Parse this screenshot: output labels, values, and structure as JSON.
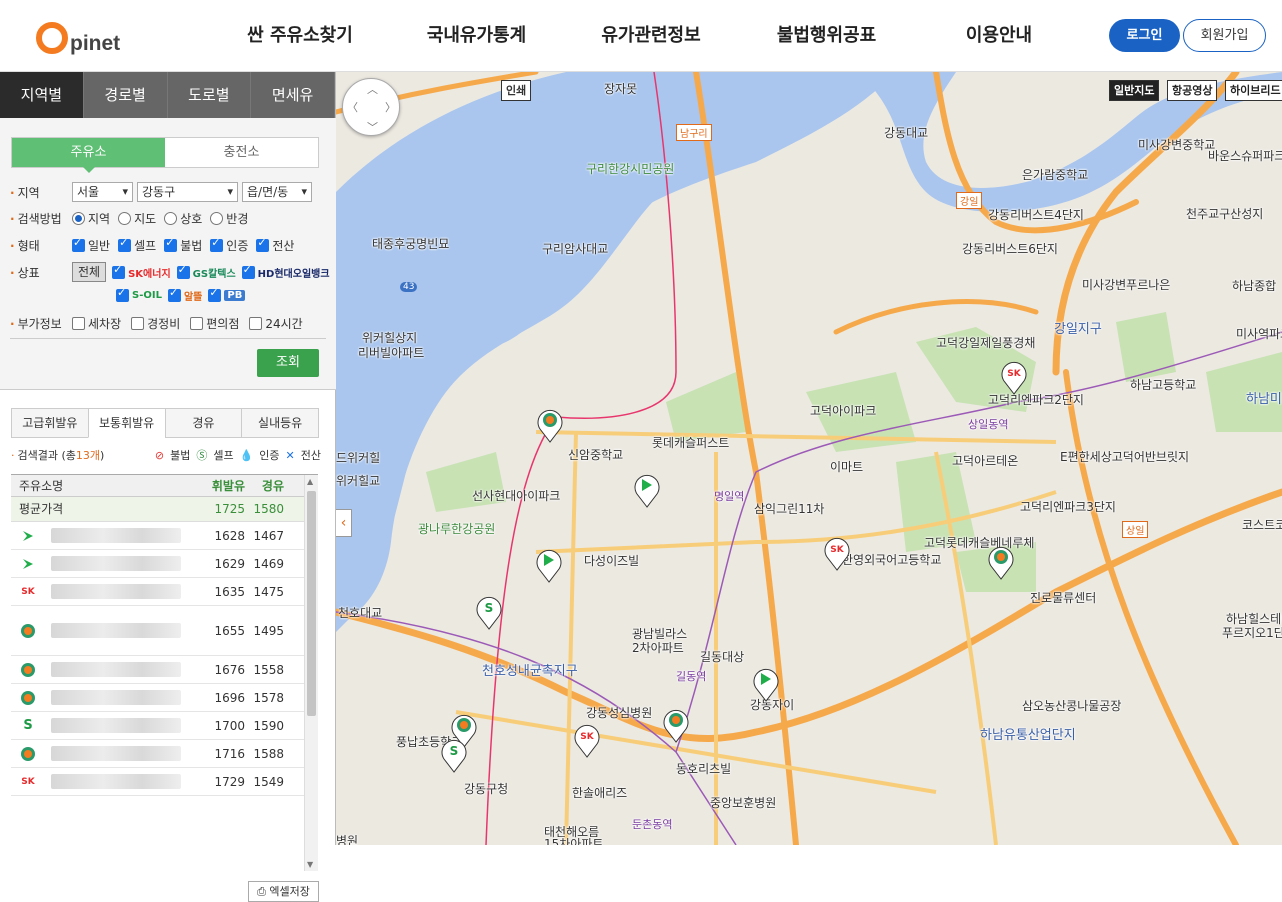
{
  "header": {
    "logo_o": "O",
    "logo_text": "pinet",
    "nav": [
      "싼 주유소찾기",
      "국내유가통계",
      "유가관련정보",
      "불법행위공표",
      "이용안내"
    ],
    "login": "로그인",
    "join": "회원가입"
  },
  "panel": {
    "tabs": [
      "지역별",
      "경로별",
      "도로별",
      "면세유"
    ],
    "subtabs": [
      "주유소",
      "충전소"
    ],
    "region": {
      "label": "지역",
      "sido": "서울",
      "sigungu": "강동구",
      "dong": "읍/면/동"
    },
    "method": {
      "label": "검색방법",
      "options": [
        "지역",
        "지도",
        "상호",
        "반경"
      ],
      "selected": "지역"
    },
    "type": {
      "label": "형태",
      "options": [
        "일반",
        "셀프",
        "불법",
        "인증",
        "전산"
      ]
    },
    "brand": {
      "label": "상표",
      "all": "전체",
      "brands": [
        "SK에너지",
        "GS칼텍스",
        "HD현대오일뱅크",
        "S-OIL",
        "알뜰",
        "PB"
      ]
    },
    "extra": {
      "label": "부가정보",
      "options": [
        "세차장",
        "경정비",
        "편의점",
        "24시간"
      ]
    },
    "search_button": "조회",
    "fuel_tabs": [
      "고급휘발유",
      "보통휘발유",
      "경유",
      "실내등유"
    ],
    "result": {
      "prefix": "검색결과 (총 ",
      "count": "13개",
      "suffix": ")"
    },
    "legend": [
      "불법",
      "셀프",
      "인증",
      "전산"
    ],
    "table": {
      "headers": [
        "주유소명",
        "휘발유",
        "경유"
      ],
      "average": {
        "name": "평균가격",
        "gasoline": "1725",
        "diesel": "1580"
      },
      "rows": [
        {
          "brand": "HD",
          "gasoline": "1628",
          "diesel": "1467"
        },
        {
          "brand": "HD",
          "gasoline": "1629",
          "diesel": "1469"
        },
        {
          "brand": "SK",
          "gasoline": "1635",
          "diesel": "1475"
        },
        {
          "brand": "GS",
          "gasoline": "1655",
          "diesel": "1495"
        },
        {
          "brand": "GS",
          "gasoline": "1676",
          "diesel": "1558"
        },
        {
          "brand": "GS",
          "gasoline": "1696",
          "diesel": "1578"
        },
        {
          "brand": "S-OIL",
          "gasoline": "1700",
          "diesel": "1590"
        },
        {
          "brand": "GS",
          "gasoline": "1716",
          "diesel": "1588"
        },
        {
          "brand": "SK",
          "gasoline": "1729",
          "diesel": "1549"
        }
      ]
    },
    "excel_button": "엑셀저장"
  },
  "map": {
    "map_types": [
      "일반지도",
      "항공영상",
      "하이브리드"
    ],
    "badge": "인쇄",
    "labels": [
      "장자못",
      "남구리",
      "구리한강시민공원",
      "강동대교",
      "태종후궁명빈묘",
      "구리암사대교",
      "위커힐상지",
      "리버빌아파트",
      "드위커힐",
      "위커힐교",
      "광나루한강공원",
      "천호대교",
      "천호성내균촉지구",
      "선사현대아이파크",
      "신암중학교",
      "롯데캐슬퍼스트",
      "명일역",
      "이마트",
      "다성이즈빌",
      "삼익그린11차",
      "광남빌라스",
      "2차아파트",
      "길동대상",
      "길동역",
      "강동자이",
      "강동성심병원",
      "풍납초등학교",
      "강동구청",
      "한솔애리즈",
      "동호리츠빌",
      "중앙보훈병원",
      "둔촌동역",
      "태천해오름",
      "15차아파트",
      "고덕아이파크",
      "상일동역",
      "고덕아르테온",
      "고덕리엔파크2단지",
      "고덕롯데캐슬베네루체",
      "상일",
      "강일",
      "강일지구",
      "고덕강일제일풍경채",
      "E편한세상고덕어반브릿지",
      "고덕리엔파크3단지",
      "하남고등학교",
      "진로물류센터",
      "삼오농산콩나물공장",
      "하남유통산업단지",
      "미사강변중학교",
      "은가람중학교",
      "강동리버스트4단지",
      "강동리버스트6단지",
      "미사강변푸르나은",
      "천주교구산성지",
      "바운스슈퍼파크",
      "하남종합",
      "미사역파크",
      "하남미",
      "코스트코",
      "하남힐스테이트",
      "푸르지오1단",
      "한영외국어고등학교",
      "병원",
      "43"
    ]
  }
}
